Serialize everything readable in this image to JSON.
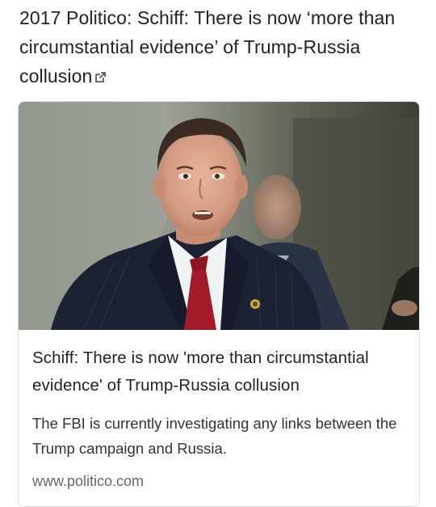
{
  "post": {
    "title": "2017 Politico: Schiff: There is now ‘more than circumstantial evidence’ of Trump-Russia collusion",
    "external_icon": "external-link-icon"
  },
  "card": {
    "image_subject": "photo",
    "headline": "Schiff: There is now 'more than circumstantial evidence' of Trump-Russia collusion",
    "description": "The FBI is currently investigating any links between the Trump campaign and Russia.",
    "domain": "www.politico.com"
  },
  "colors": {
    "title_text": "#222222",
    "body_text": "#333333",
    "domain_text": "#666666",
    "card_border": "#dddddd"
  }
}
